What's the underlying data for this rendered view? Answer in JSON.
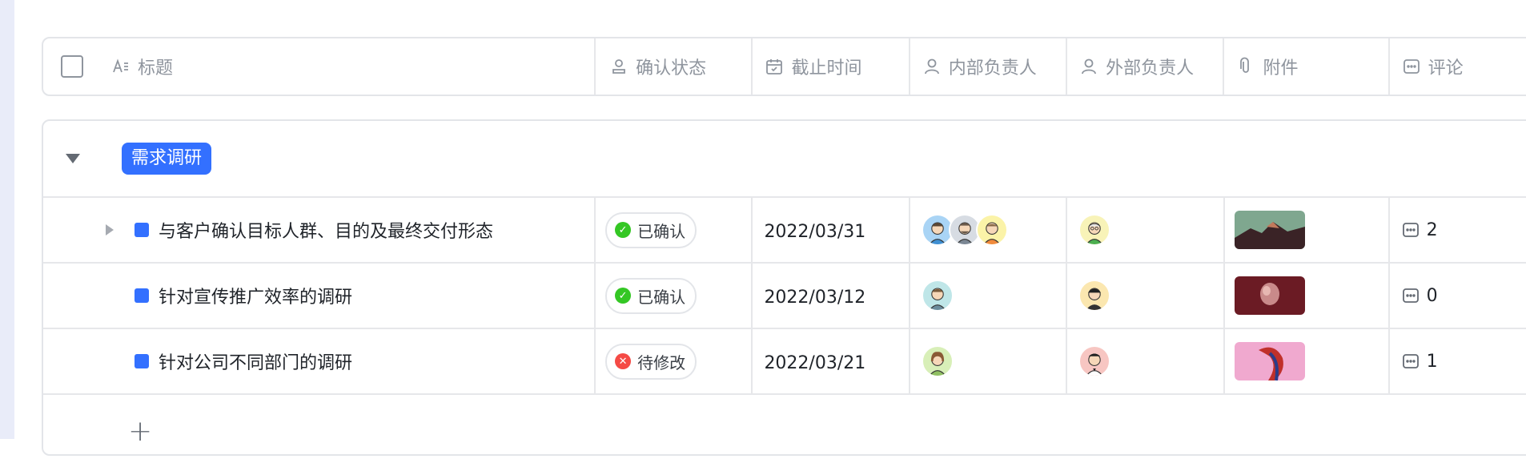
{
  "header": {
    "columns": {
      "title": "标题",
      "status": "确认状态",
      "deadline": "截止时间",
      "internal_owner": "内部负责人",
      "external_owner": "外部负责人",
      "attachment": "附件",
      "comment": "评论"
    }
  },
  "group": {
    "label": "需求调研",
    "color": "#3370ff",
    "rows": [
      {
        "title": "与客户确认目标人群、目的及最终交付形态",
        "status": "已确认",
        "status_color": "#34c724",
        "deadline": "2022/03/31",
        "internal_avatars": 3,
        "external_avatars": 1,
        "comment_count": "2"
      },
      {
        "title": "针对宣传推广效率的调研",
        "status": "已确认",
        "status_color": "#34c724",
        "deadline": "2022/03/12",
        "internal_avatars": 1,
        "external_avatars": 1,
        "comment_count": "0"
      },
      {
        "title": "针对公司不同部门的调研",
        "status": "待修改",
        "status_color": "#f54a45",
        "deadline": "2022/03/21",
        "internal_avatars": 1,
        "external_avatars": 1,
        "comment_count": "1"
      }
    ]
  },
  "add_row": "+"
}
